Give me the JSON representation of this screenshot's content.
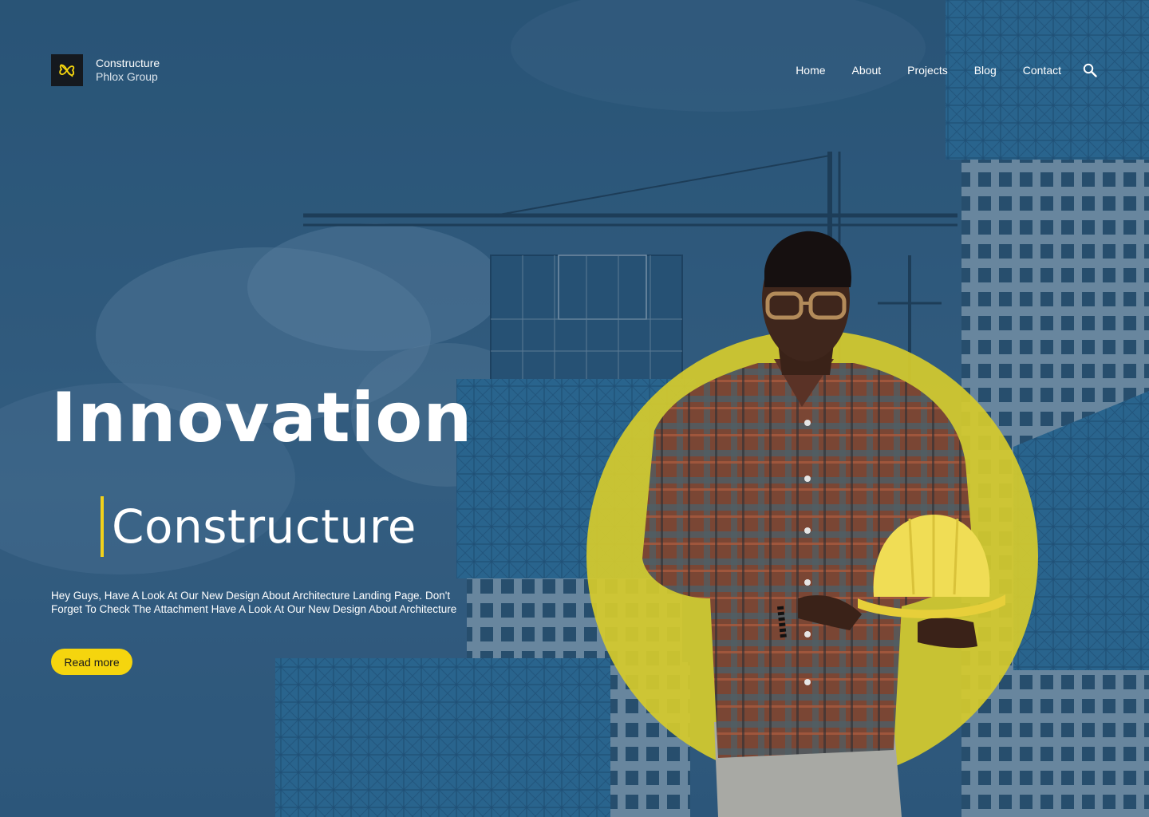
{
  "brand": {
    "name": "Constructure",
    "subtitle": "Phlox Group",
    "logo_icon": "butterfly-logo-icon"
  },
  "nav": {
    "items": [
      {
        "label": "Home"
      },
      {
        "label": "About"
      },
      {
        "label": "Projects"
      },
      {
        "label": "Blog"
      },
      {
        "label": "Contact"
      }
    ],
    "search_icon": "search-icon"
  },
  "hero": {
    "title": "Innovation",
    "subtitle": "Constructure",
    "description": "Hey Guys, Have A Look At Our New Design About Architecture Landing Page. Don't Forget To Check The Attachment Have A Look At Our New Design About Architecture",
    "cta_label": "Read more"
  },
  "colors": {
    "accent": "#f5d50e",
    "background_overlay": "#35587a",
    "circle": "#d9cc2c",
    "logo_bg": "#15191f"
  }
}
